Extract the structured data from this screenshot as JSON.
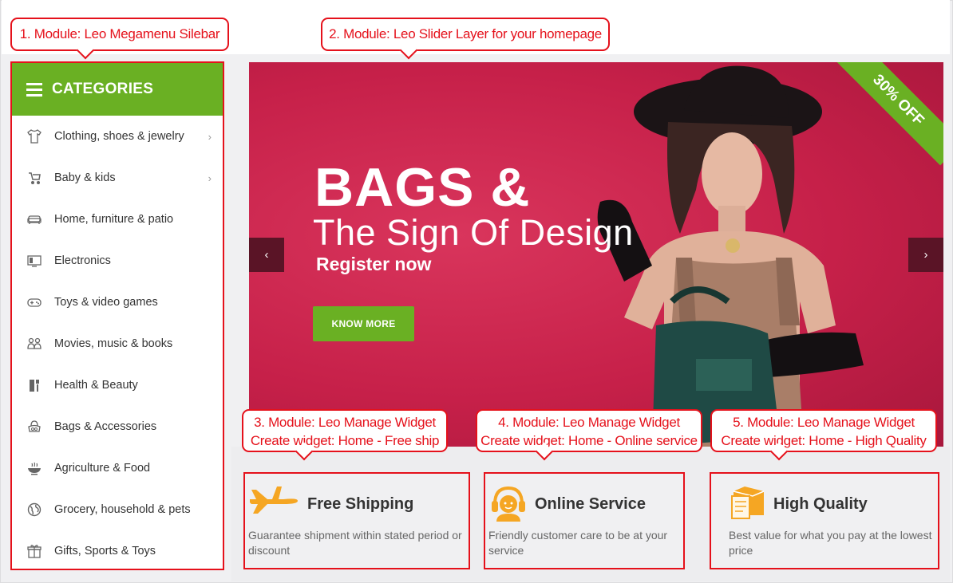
{
  "callouts": {
    "c1": "1. Module: Leo Megamenu Silebar",
    "c2": "2. Module: Leo Slider Layer for your homepage",
    "c3_l1": "3. Module: Leo Manage Widget",
    "c3_l2": "Create widget: Home - Free ship",
    "c4_l1": "4. Module: Leo Manage Widget",
    "c4_l2": "Create widget: Home - Online service",
    "c5_l1": "5. Module: Leo Manage Widget",
    "c5_l2": "Create widget: Home - High Quality"
  },
  "sidebar": {
    "header": "CATEGORIES",
    "items": [
      {
        "label": "Clothing, shoes & jewelry",
        "icon": "shirt-icon",
        "has_sub": true
      },
      {
        "label": "Baby & kids",
        "icon": "stroller-icon",
        "has_sub": true
      },
      {
        "label": "Home, furniture & patio",
        "icon": "sofa-icon",
        "has_sub": false
      },
      {
        "label": "Electronics",
        "icon": "tv-icon",
        "has_sub": false
      },
      {
        "label": "Toys & video games",
        "icon": "gamepad-icon",
        "has_sub": false
      },
      {
        "label": "Movies, music & books",
        "icon": "people-icon",
        "has_sub": false
      },
      {
        "label": "Health & Beauty",
        "icon": "bottle-icon",
        "has_sub": false
      },
      {
        "label": "Bags & Accessories",
        "icon": "bag-icon",
        "has_sub": false
      },
      {
        "label": "Agriculture & Food",
        "icon": "food-bowl-icon",
        "has_sub": false
      },
      {
        "label": "Grocery, household & pets",
        "icon": "globe-icon",
        "has_sub": false
      },
      {
        "label": "Gifts, Sports & Toys",
        "icon": "gift-icon",
        "has_sub": false
      }
    ]
  },
  "slider": {
    "title": "BAGS &",
    "subtitle": "The Sign Of Design",
    "register": "Register now",
    "button": "KNOW MORE",
    "ribbon": "30% OFF",
    "prev": "‹",
    "next": "›"
  },
  "features": [
    {
      "title": "Free Shipping",
      "desc": "Guarantee shipment within stated period or discount",
      "icon": "airplane-icon"
    },
    {
      "title": "Online Service",
      "desc": "Friendly customer care to be at your service",
      "icon": "support-agent-icon"
    },
    {
      "title": "High Quality",
      "desc": "Best value for what you pay at the lowest price",
      "icon": "quality-box-icon"
    }
  ],
  "colors": {
    "accent_green": "#6ab023",
    "callout_red": "#e5111b",
    "slider_bg": "#c8264d"
  }
}
